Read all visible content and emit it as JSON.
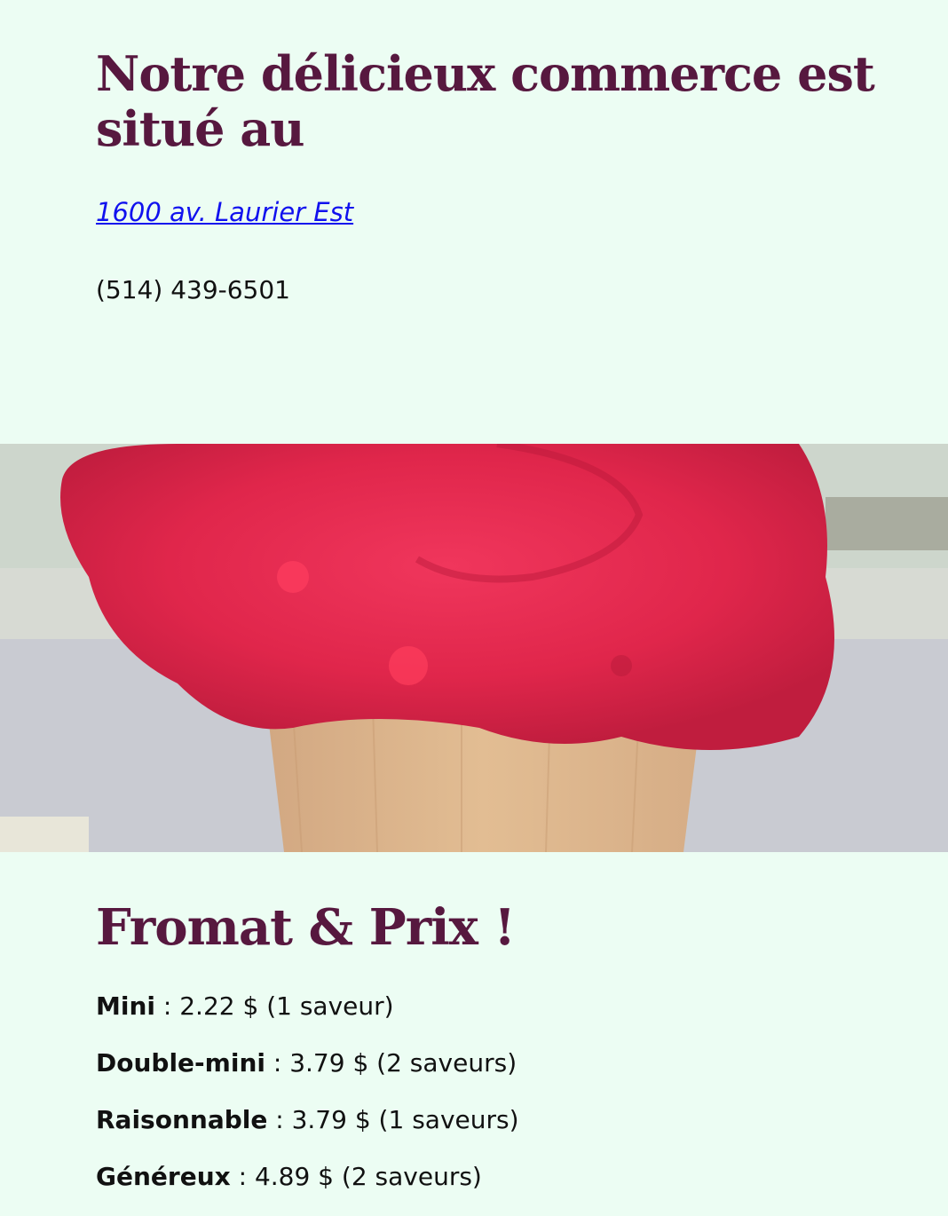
{
  "location": {
    "heading": "Notre délicieux commerce est situé au",
    "address": "1600 av. Laurier Est",
    "phone": "(514) 439-6501"
  },
  "photo": {
    "description_icon": "ice-cream-cone-photo"
  },
  "prices": {
    "heading": "Fromat & Prix !",
    "items": [
      {
        "name": "Mini",
        "detail": " : 2.22 $ (1 saveur)"
      },
      {
        "name": "Double-mini",
        "detail": " : 3.79 $ (2 saveurs)"
      },
      {
        "name": "Raisonnable",
        "detail": " : 3.79 $ (1 saveurs)"
      },
      {
        "name": "Généreux",
        "detail": " : 4.89 $ (2 saveurs)"
      }
    ]
  },
  "colors": {
    "background": "#ecfdf3",
    "heading": "#57183f",
    "link": "#1111ee",
    "sorbet": "#e2284e",
    "cone": "#dcb48a"
  }
}
